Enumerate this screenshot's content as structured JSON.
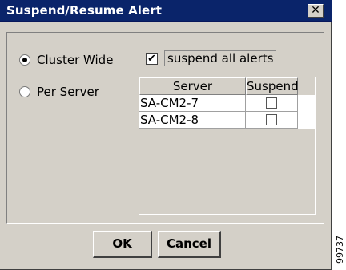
{
  "window": {
    "title": "Suspend/Resume Alert",
    "close_glyph": "✕"
  },
  "scope": {
    "cluster_wide_label": "Cluster Wide",
    "cluster_wide_selected": true,
    "per_server_label": "Per Server",
    "per_server_selected": false,
    "suspend_all_label": "suspend all alerts",
    "suspend_all_checked": true,
    "check_glyph": "✔"
  },
  "table": {
    "columns": [
      "Server",
      "Suspend"
    ],
    "rows": [
      {
        "server": "SA-CM2-7",
        "suspend": false
      },
      {
        "server": "SA-CM2-8",
        "suspend": false
      }
    ]
  },
  "buttons": {
    "ok_label": "OK",
    "cancel_label": "Cancel"
  },
  "figure_id": "99737"
}
